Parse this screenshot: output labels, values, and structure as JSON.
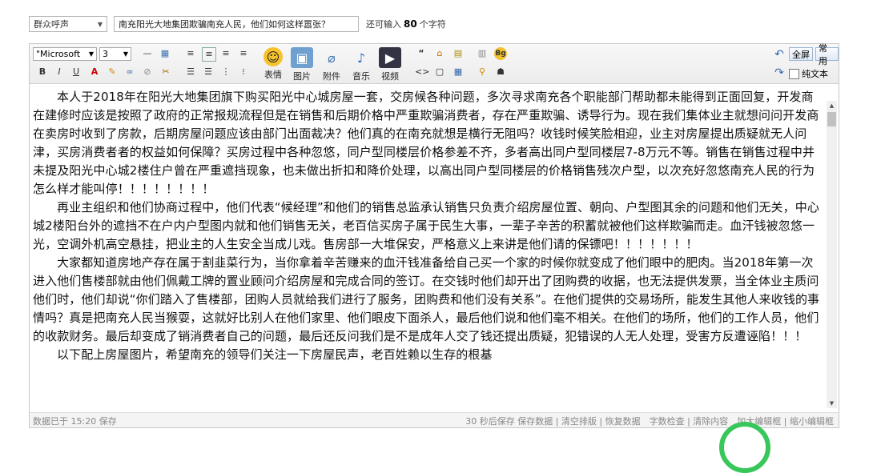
{
  "topbar": {
    "category": "群众呼声",
    "title_value": "南充阳光大地集团欺骗南充人民，他们如何这样嚣张？",
    "hint_prefix": "还可输入",
    "hint_count": "80",
    "hint_suffix": "个字符"
  },
  "toolbar": {
    "font": "\"Microsoft",
    "size": "3",
    "emoji_label": "表情",
    "image_label": "图片",
    "attach_label": "附件",
    "music_label": "音乐",
    "video_label": "视频",
    "fullscreen_label": "全屏",
    "common_label": "常用",
    "plaintext_label": "纯文本"
  },
  "content": {
    "paragraphs": [
      "本人于2018年在阳光大地集团旗下购买阳光中心城房屋一套，交房候各种问题，多次寻求南充各个职能部门帮助都未能得到正面回复，开发商在建修时应该是按照了政府的正常报规流程但是在销售和后期价格中严重欺骗消费者，存在严重欺骗、诱导行为。现在我们集体业主就想问问开发商在卖房时收到了房款，后期房屋问题应该由部门出面裁决？他们真的在南充就想是横行无阻吗？收钱时候笑脸相迎，业主对房屋提出质疑就无人问津，买房消费者者的权益如何保障？买房过程中各种忽悠，同户型同楼层价格参差不齐，多者高出同户型同楼层7-8万元不等。销售在销售过程中并未提及阳光中心城2楼住户曾在严重遮挡现象，也未做出折扣和降价处理，以高出同户型同楼层的价格销售残次户型，以次充好忽悠南充人民的行为怎么样才能叫停！！！！！！！！",
      "再业主组织和他们协商过程中，他们代表“候经理”和他们的销售总监承认销售只负责介绍房屋位置、朝向、户型图其余的问题和他们无关，中心城2楼阳台外的遮挡不在户内户型图内就和他们销售无关，老百信买房子属于民生大事，一辈子辛苦的积蓄就被他们这样欺骗而走。血汗钱被忽悠一光，空调外机高空悬挂，把业主的人生安全当成儿戏。售房部一大堆保安，严格意义上来讲是他们请的保镖吧！！！！！！！",
      "大家都知道房地产存在属于割韭菜行为，当你拿着辛苦赚来的血汗钱准备给自己买一个家的时候你就变成了他们眼中的肥肉。当2018年第一次进入他们售楼部就由他们佩戴工牌的置业顾问介绍房屋和完成合同的签订。在交钱时他们却开出了团购费的收据，也无法提供发票，当全体业主质问他们时，他们却说“你们踏入了售楼部，团购人员就给我们进行了服务，团购费和他们没有关系”。在他们提供的交易场所，能发生其他人来收钱的事情吗？真是把南充人民当猴耍，这就好比别人在他们家里、他们眼皮下面杀人，最后他们说和他们毫不相关。在他们的场所，他们的工作人员，他们的收款财务。最后却变成了销消费者自己的问题，最后还反问我们是不是成年人交了钱还提出质疑，犯错误的人无人处理，受害方反遭诬陷！！！",
      "以下配上房屋图片，希望南充的领导们关注一下房屋民声，老百姓赖以生存的根基"
    ]
  },
  "status": {
    "left": "数据已于 15:20 保存",
    "right": "30 秒后保存 保存数据 | 清空排版 | 恢复数据　字数检查 | 清除内容　加大编辑框 | 缩小编辑框"
  }
}
